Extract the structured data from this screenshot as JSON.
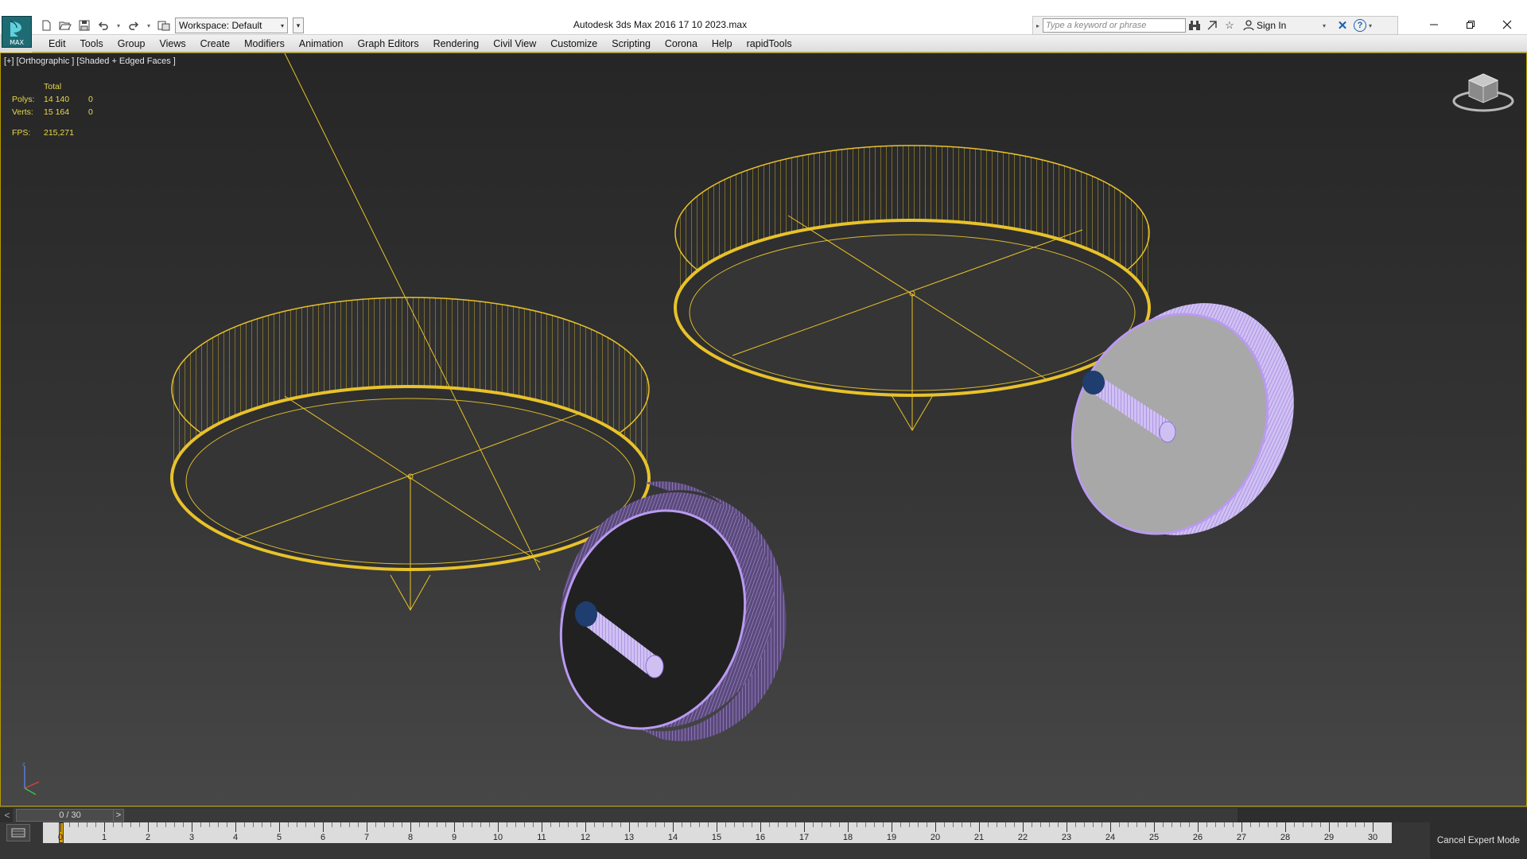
{
  "app": {
    "logo_text": "MAX",
    "title": "Autodesk 3ds Max 2016     17 10 2023.max"
  },
  "quick_access": {
    "workspace_label": "Workspace: Default"
  },
  "search": {
    "placeholder": "Type a keyword or phrase",
    "sign_in_label": "Sign In"
  },
  "menu": {
    "items": [
      "Edit",
      "Tools",
      "Group",
      "Views",
      "Create",
      "Modifiers",
      "Animation",
      "Graph Editors",
      "Rendering",
      "Civil View",
      "Customize",
      "Scripting",
      "Corona",
      "Help",
      "rapidTools"
    ]
  },
  "viewport": {
    "label": "[+] [Orthographic ] [Shaded + Edged Faces ]",
    "stats": {
      "header": "Total",
      "polys_label": "Polys:",
      "polys_total": "14 140",
      "polys_selected": "0",
      "verts_label": "Verts:",
      "verts_total": "15 164",
      "verts_selected": "0",
      "fps_label": "FPS:",
      "fps_value": "215,271"
    },
    "colors": {
      "selection_yellow": "#e8c22a",
      "wireframe_purple": "#b99af0",
      "border_gold": "#b49a00"
    }
  },
  "timeslider": {
    "prev_label": "<",
    "position_label": "0 / 30",
    "next_label": ">"
  },
  "trackbar": {
    "frames": [
      "0",
      "1",
      "2",
      "3",
      "4",
      "5",
      "6",
      "7",
      "8",
      "9",
      "10",
      "11",
      "12",
      "13",
      "14",
      "15",
      "16",
      "17",
      "18",
      "19",
      "20",
      "21",
      "22",
      "23",
      "24",
      "25",
      "26",
      "27",
      "28",
      "29",
      "30"
    ],
    "cancel_expert_label": "Cancel Expert Mode"
  }
}
